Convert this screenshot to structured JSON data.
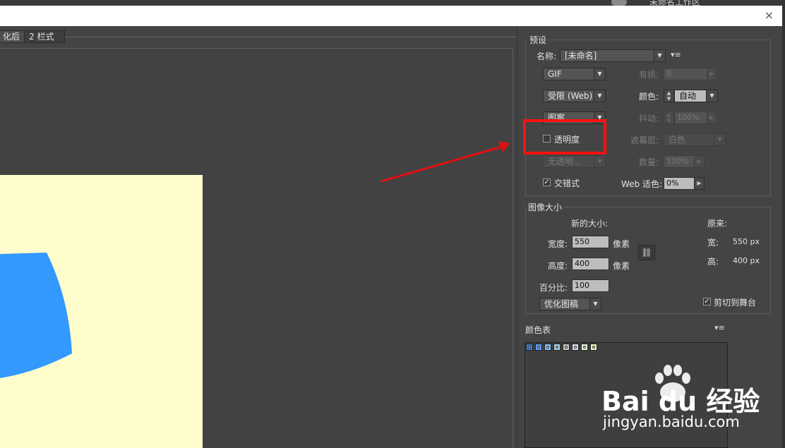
{
  "window": {
    "topstrip_text": "未命名工作区",
    "close_glyph": "×"
  },
  "tabs": [
    {
      "label": "优化后",
      "visible_label": "化后"
    },
    {
      "label": "2 栏式"
    }
  ],
  "preset": {
    "legend": "预设",
    "name_label": "名称:",
    "name_value": "[未命名]",
    "format": "GIF",
    "lossy_label": "有损:",
    "lossy_value": "0",
    "palette": "受限 (Web)",
    "colors_label": "颜色:",
    "colors_value": "自动",
    "dither_algo": "图案",
    "dither_label": "抖动:",
    "dither_value": "100%",
    "transparency_label": "透明度",
    "transparency_checked": false,
    "matte_label": "遮幕层:",
    "matte_value": "白色",
    "transp_dither": "无透明...",
    "amount_label": "数量:",
    "amount_value": "100%",
    "interlaced_label": "交错式",
    "interlaced_checked": true,
    "websnap_label": "Web 适色:",
    "websnap_value": "0%"
  },
  "image_size": {
    "legend": "图像大小",
    "new_size_label": "新的大小:",
    "original_label": "原来:",
    "width_label": "宽度:",
    "width_value": "550",
    "height_label": "高度:",
    "height_value": "400",
    "unit_label": "像素",
    "orig_w_label": "宽:",
    "orig_w_value": "550 px",
    "orig_h_label": "高:",
    "orig_h_value": "400 px",
    "percent_label": "百分比:",
    "percent_value": "100",
    "quality": "优化图稿",
    "clip_label": "剪切到舞台",
    "clip_checked": true
  },
  "color_table": {
    "title": "颜色表",
    "swatches": [
      "#3a7bd5",
      "#5aa0ff",
      "#8ec1ff",
      "#a7d3e8",
      "#c6c6c6",
      "#d9d9f0",
      "#e8f8e0",
      "#f6f6c0"
    ]
  },
  "colors": {
    "accent_highlight": "#ff1010",
    "arrow": "#e01010",
    "artboard": "#fffdcc",
    "shape": "#3399ff"
  },
  "icons": {
    "menu": "menu-icon",
    "link": "link-icon",
    "close": "close-icon"
  },
  "watermark": {
    "brand": "Bai du 经验",
    "url": "jingyan.baidu.com"
  }
}
